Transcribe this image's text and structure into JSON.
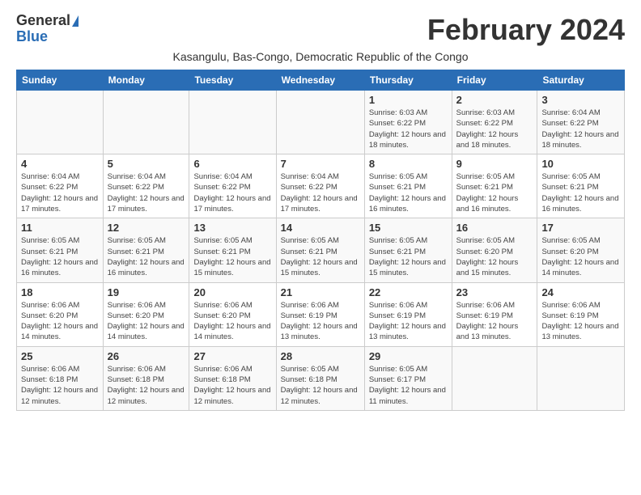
{
  "logo": {
    "general": "General",
    "blue": "Blue"
  },
  "title": "February 2024",
  "subtitle": "Kasangulu, Bas-Congo, Democratic Republic of the Congo",
  "days_header": [
    "Sunday",
    "Monday",
    "Tuesday",
    "Wednesday",
    "Thursday",
    "Friday",
    "Saturday"
  ],
  "weeks": [
    [
      {
        "day": "",
        "info": ""
      },
      {
        "day": "",
        "info": ""
      },
      {
        "day": "",
        "info": ""
      },
      {
        "day": "",
        "info": ""
      },
      {
        "day": "1",
        "info": "Sunrise: 6:03 AM\nSunset: 6:22 PM\nDaylight: 12 hours and 18 minutes."
      },
      {
        "day": "2",
        "info": "Sunrise: 6:03 AM\nSunset: 6:22 PM\nDaylight: 12 hours and 18 minutes."
      },
      {
        "day": "3",
        "info": "Sunrise: 6:04 AM\nSunset: 6:22 PM\nDaylight: 12 hours and 18 minutes."
      }
    ],
    [
      {
        "day": "4",
        "info": "Sunrise: 6:04 AM\nSunset: 6:22 PM\nDaylight: 12 hours and 17 minutes."
      },
      {
        "day": "5",
        "info": "Sunrise: 6:04 AM\nSunset: 6:22 PM\nDaylight: 12 hours and 17 minutes."
      },
      {
        "day": "6",
        "info": "Sunrise: 6:04 AM\nSunset: 6:22 PM\nDaylight: 12 hours and 17 minutes."
      },
      {
        "day": "7",
        "info": "Sunrise: 6:04 AM\nSunset: 6:22 PM\nDaylight: 12 hours and 17 minutes."
      },
      {
        "day": "8",
        "info": "Sunrise: 6:05 AM\nSunset: 6:21 PM\nDaylight: 12 hours and 16 minutes."
      },
      {
        "day": "9",
        "info": "Sunrise: 6:05 AM\nSunset: 6:21 PM\nDaylight: 12 hours and 16 minutes."
      },
      {
        "day": "10",
        "info": "Sunrise: 6:05 AM\nSunset: 6:21 PM\nDaylight: 12 hours and 16 minutes."
      }
    ],
    [
      {
        "day": "11",
        "info": "Sunrise: 6:05 AM\nSunset: 6:21 PM\nDaylight: 12 hours and 16 minutes."
      },
      {
        "day": "12",
        "info": "Sunrise: 6:05 AM\nSunset: 6:21 PM\nDaylight: 12 hours and 16 minutes."
      },
      {
        "day": "13",
        "info": "Sunrise: 6:05 AM\nSunset: 6:21 PM\nDaylight: 12 hours and 15 minutes."
      },
      {
        "day": "14",
        "info": "Sunrise: 6:05 AM\nSunset: 6:21 PM\nDaylight: 12 hours and 15 minutes."
      },
      {
        "day": "15",
        "info": "Sunrise: 6:05 AM\nSunset: 6:21 PM\nDaylight: 12 hours and 15 minutes."
      },
      {
        "day": "16",
        "info": "Sunrise: 6:05 AM\nSunset: 6:20 PM\nDaylight: 12 hours and 15 minutes."
      },
      {
        "day": "17",
        "info": "Sunrise: 6:05 AM\nSunset: 6:20 PM\nDaylight: 12 hours and 14 minutes."
      }
    ],
    [
      {
        "day": "18",
        "info": "Sunrise: 6:06 AM\nSunset: 6:20 PM\nDaylight: 12 hours and 14 minutes."
      },
      {
        "day": "19",
        "info": "Sunrise: 6:06 AM\nSunset: 6:20 PM\nDaylight: 12 hours and 14 minutes."
      },
      {
        "day": "20",
        "info": "Sunrise: 6:06 AM\nSunset: 6:20 PM\nDaylight: 12 hours and 14 minutes."
      },
      {
        "day": "21",
        "info": "Sunrise: 6:06 AM\nSunset: 6:19 PM\nDaylight: 12 hours and 13 minutes."
      },
      {
        "day": "22",
        "info": "Sunrise: 6:06 AM\nSunset: 6:19 PM\nDaylight: 12 hours and 13 minutes."
      },
      {
        "day": "23",
        "info": "Sunrise: 6:06 AM\nSunset: 6:19 PM\nDaylight: 12 hours and 13 minutes."
      },
      {
        "day": "24",
        "info": "Sunrise: 6:06 AM\nSunset: 6:19 PM\nDaylight: 12 hours and 13 minutes."
      }
    ],
    [
      {
        "day": "25",
        "info": "Sunrise: 6:06 AM\nSunset: 6:18 PM\nDaylight: 12 hours and 12 minutes."
      },
      {
        "day": "26",
        "info": "Sunrise: 6:06 AM\nSunset: 6:18 PM\nDaylight: 12 hours and 12 minutes."
      },
      {
        "day": "27",
        "info": "Sunrise: 6:06 AM\nSunset: 6:18 PM\nDaylight: 12 hours and 12 minutes."
      },
      {
        "day": "28",
        "info": "Sunrise: 6:05 AM\nSunset: 6:18 PM\nDaylight: 12 hours and 12 minutes."
      },
      {
        "day": "29",
        "info": "Sunrise: 6:05 AM\nSunset: 6:17 PM\nDaylight: 12 hours and 11 minutes."
      },
      {
        "day": "",
        "info": ""
      },
      {
        "day": "",
        "info": ""
      }
    ]
  ]
}
